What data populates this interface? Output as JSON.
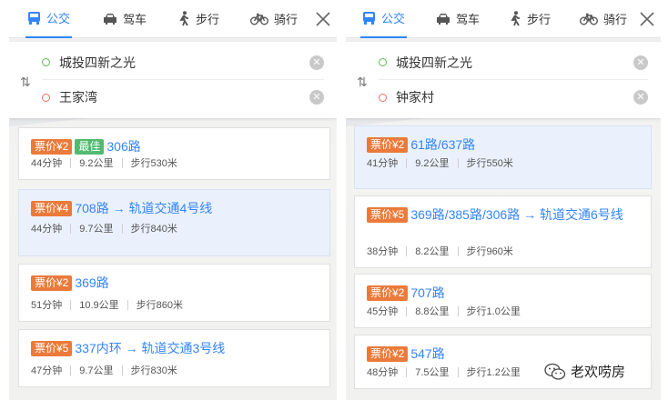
{
  "left": {
    "tabs": [
      {
        "label": "公交",
        "icon": "bus-icon",
        "active": true
      },
      {
        "label": "驾车",
        "icon": "car-icon"
      },
      {
        "label": "步行",
        "icon": "walk-icon"
      },
      {
        "label": "骑行",
        "icon": "bike-icon"
      }
    ],
    "from": "城投四新之光",
    "to": "王家湾",
    "routes": [
      {
        "fare": "票价¥2",
        "best": "最佳",
        "name": "306路",
        "time": "44分钟",
        "dist": "9.2公里",
        "walk": "步行530米"
      },
      {
        "fare": "票价¥4",
        "name": "708路 → 轨道交通4号线",
        "time": "44分钟",
        "dist": "9.7公里",
        "walk": "步行840米"
      },
      {
        "fare": "票价¥2",
        "name": "369路",
        "time": "51分钟",
        "dist": "10.9公里",
        "walk": "步行860米"
      },
      {
        "fare": "票价¥5",
        "name": "337内环 → 轨道交通3号线",
        "time": "47分钟",
        "dist": "9.7公里",
        "walk": "步行830米"
      }
    ]
  },
  "right": {
    "tabs": [
      {
        "label": "公交",
        "icon": "bus-icon",
        "active": true
      },
      {
        "label": "驾车",
        "icon": "car-icon"
      },
      {
        "label": "步行",
        "icon": "walk-icon"
      },
      {
        "label": "骑行",
        "icon": "bike-icon"
      }
    ],
    "from": "城投四新之光",
    "to": "钟家村",
    "routes": [
      {
        "fare": "票价¥2",
        "name": "61路/637路",
        "time": "41分钟",
        "dist": "9.2公里",
        "walk": "步行550米"
      },
      {
        "fare": "票价¥5",
        "name": "369路/385路/306路 → 轨道交通6号线",
        "time": "38分钟",
        "dist": "8.2公里",
        "walk": "步行960米"
      },
      {
        "fare": "票价¥2",
        "name": "707路",
        "time": "45分钟",
        "dist": "8.8公里",
        "walk": "步行1.0公里"
      },
      {
        "fare": "票价¥2",
        "name": "547路",
        "time": "48分钟",
        "dist": "7.5公里",
        "walk": "步行1.2公里"
      }
    ]
  },
  "watermark": "老欢唠房",
  "colors": {
    "accent": "#3385ff",
    "fare": "#eb7a3a",
    "best": "#52b96f",
    "selected": "#ebf1fc"
  }
}
